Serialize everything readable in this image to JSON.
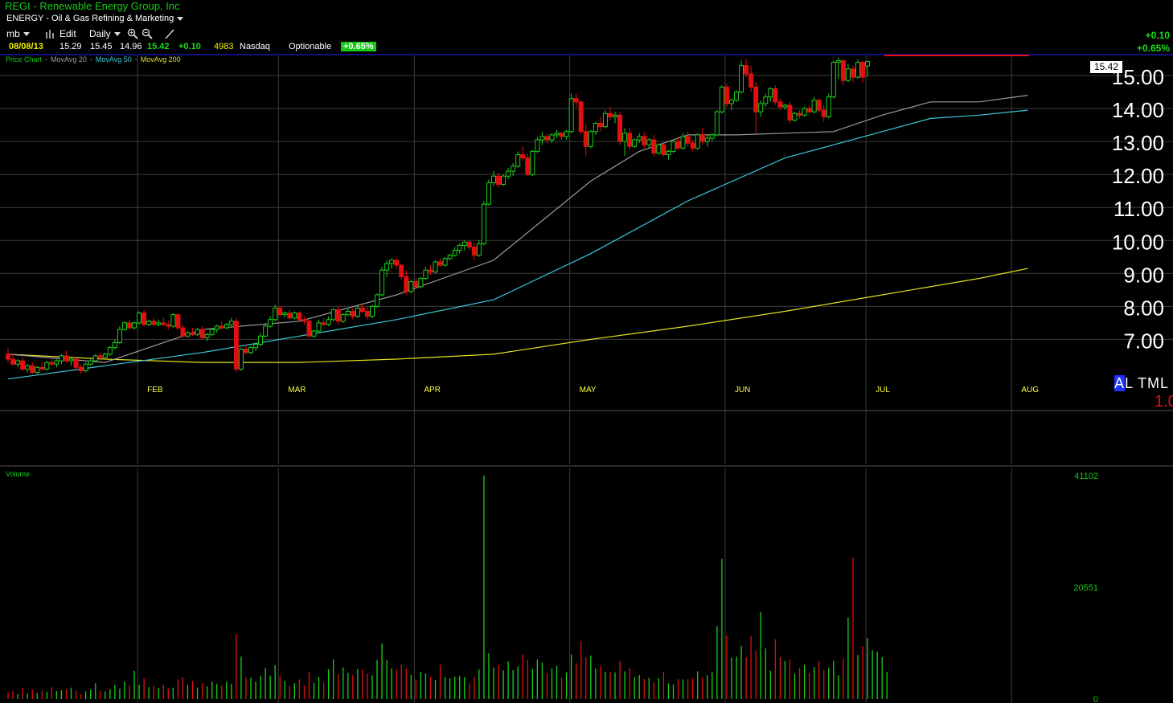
{
  "header": {
    "title": "REGI - Renewable Energy Group, Inc",
    "sector": "ENERGY - Oil & Gas Refining & Marketing",
    "toolbar": {
      "profile": "mb",
      "edit": "Edit",
      "period": "Daily"
    },
    "quote": {
      "date": "08/08/13",
      "open": "15.29",
      "high": "15.45",
      "low": "14.96",
      "close": "15.42",
      "change": "+0.10",
      "volume": "4983",
      "exchange": "Nasdaq",
      "optionable": "Optionable",
      "pct": "+0.65%"
    },
    "right_change": "+0.10",
    "right_pct": "+0.65%"
  },
  "legend": {
    "price": "Price Chart",
    "ma20": "MovAvg 20",
    "ma50": "MovAvg 50",
    "ma200": "MovAvg 200"
  },
  "volume_label": "Volume",
  "last_price_label": "15.42",
  "tml": {
    "a": "A",
    "rest": "L TML",
    "value": "1.0"
  },
  "colors": {
    "up": "#18d018",
    "down": "#e01010",
    "ma20": "#9a9a9a",
    "ma50": "#3cc8d8",
    "ma200": "#e0e020",
    "grid": "#3c3c3c",
    "axis_text": "#ffffff"
  },
  "chart_data": {
    "type": "candlestick",
    "y_range": [
      6.0,
      15.6
    ],
    "y_ticks": [
      "15.00",
      "14.00",
      "13.00",
      "12.00",
      "11.00",
      "10.00",
      "9.00",
      "8.00",
      "7.00"
    ],
    "month_labels": [
      {
        "label": "FEB",
        "index": 28
      },
      {
        "label": "MAR",
        "index": 57
      },
      {
        "label": "APR",
        "index": 85
      },
      {
        "label": "MAY",
        "index": 117
      },
      {
        "label": "JUN",
        "index": 149
      },
      {
        "label": "JUL",
        "index": 178
      },
      {
        "label": "AUG",
        "index": 208
      }
    ],
    "bars": [
      [
        6.55,
        6.75,
        6.3,
        6.4
      ],
      [
        6.4,
        6.55,
        6.2,
        6.25
      ],
      [
        6.25,
        6.4,
        6.15,
        6.35
      ],
      [
        6.35,
        6.45,
        6.05,
        6.1
      ],
      [
        6.1,
        6.25,
        6.0,
        6.2
      ],
      [
        6.2,
        6.3,
        5.95,
        6.0
      ],
      [
        6.0,
        6.2,
        5.95,
        6.15
      ],
      [
        6.15,
        6.3,
        6.05,
        6.1
      ],
      [
        6.1,
        6.35,
        6.05,
        6.3
      ],
      [
        6.3,
        6.45,
        6.2,
        6.25
      ],
      [
        6.25,
        6.4,
        6.15,
        6.35
      ],
      [
        6.35,
        6.55,
        6.25,
        6.5
      ],
      [
        6.5,
        6.65,
        6.3,
        6.35
      ],
      [
        6.35,
        6.45,
        6.2,
        6.4
      ],
      [
        6.4,
        6.45,
        6.1,
        6.15
      ],
      [
        6.15,
        6.25,
        5.95,
        6.05
      ],
      [
        6.05,
        6.3,
        6.0,
        6.25
      ],
      [
        6.25,
        6.4,
        6.2,
        6.35
      ],
      [
        6.35,
        6.55,
        6.3,
        6.5
      ],
      [
        6.5,
        6.6,
        6.35,
        6.45
      ],
      [
        6.45,
        6.6,
        6.4,
        6.55
      ],
      [
        6.55,
        6.8,
        6.5,
        6.75
      ],
      [
        6.75,
        7.0,
        6.7,
        6.9
      ],
      [
        6.9,
        7.4,
        6.85,
        7.3
      ],
      [
        7.3,
        7.55,
        7.25,
        7.5
      ],
      [
        7.5,
        7.6,
        7.3,
        7.35
      ],
      [
        7.35,
        7.55,
        7.3,
        7.5
      ],
      [
        7.5,
        7.85,
        7.45,
        7.8
      ],
      [
        7.8,
        7.9,
        7.4,
        7.45
      ],
      [
        7.45,
        7.6,
        7.4,
        7.55
      ],
      [
        7.55,
        7.65,
        7.4,
        7.45
      ],
      [
        7.45,
        7.6,
        7.4,
        7.5
      ],
      [
        7.5,
        7.65,
        7.4,
        7.45
      ],
      [
        7.45,
        7.55,
        7.3,
        7.4
      ],
      [
        7.4,
        7.8,
        7.35,
        7.75
      ],
      [
        7.75,
        7.8,
        7.3,
        7.35
      ],
      [
        7.35,
        7.45,
        7.05,
        7.1
      ],
      [
        7.1,
        7.25,
        7.05,
        7.2
      ],
      [
        7.2,
        7.35,
        7.1,
        7.15
      ],
      [
        7.15,
        7.35,
        7.1,
        7.3
      ],
      [
        7.3,
        7.4,
        7.0,
        7.05
      ],
      [
        7.05,
        7.2,
        6.95,
        7.15
      ],
      [
        7.15,
        7.35,
        7.1,
        7.3
      ],
      [
        7.3,
        7.45,
        7.2,
        7.4
      ],
      [
        7.4,
        7.55,
        7.3,
        7.35
      ],
      [
        7.35,
        7.5,
        7.3,
        7.45
      ],
      [
        7.45,
        7.65,
        7.4,
        7.55
      ],
      [
        7.55,
        7.65,
        6.0,
        6.1
      ],
      [
        6.1,
        6.75,
        6.05,
        6.7
      ],
      [
        6.7,
        6.85,
        6.55,
        6.6
      ],
      [
        6.6,
        6.8,
        6.55,
        6.75
      ],
      [
        6.75,
        6.9,
        6.65,
        6.85
      ],
      [
        6.85,
        7.2,
        6.8,
        7.1
      ],
      [
        7.1,
        7.5,
        7.05,
        7.4
      ],
      [
        7.4,
        7.7,
        7.35,
        7.6
      ],
      [
        7.6,
        8.05,
        7.55,
        7.95
      ],
      [
        7.95,
        8.0,
        7.7,
        7.75
      ],
      [
        7.75,
        7.85,
        7.65,
        7.8
      ],
      [
        7.8,
        7.9,
        7.6,
        7.65
      ],
      [
        7.65,
        7.85,
        7.6,
        7.8
      ],
      [
        7.8,
        7.85,
        7.55,
        7.6
      ],
      [
        7.6,
        7.7,
        7.45,
        7.55
      ],
      [
        7.55,
        7.6,
        7.05,
        7.1
      ],
      [
        7.1,
        7.3,
        7.05,
        7.25
      ],
      [
        7.25,
        7.6,
        7.2,
        7.5
      ],
      [
        7.5,
        7.65,
        7.4,
        7.45
      ],
      [
        7.45,
        7.7,
        7.4,
        7.6
      ],
      [
        7.6,
        7.95,
        7.55,
        7.9
      ],
      [
        7.9,
        8.0,
        7.45,
        7.55
      ],
      [
        7.55,
        7.8,
        7.5,
        7.75
      ],
      [
        7.75,
        7.95,
        7.7,
        7.85
      ],
      [
        7.85,
        7.95,
        7.6,
        7.7
      ],
      [
        7.7,
        8.05,
        7.65,
        7.95
      ],
      [
        7.95,
        8.1,
        7.8,
        7.85
      ],
      [
        7.85,
        8.0,
        7.6,
        7.7
      ],
      [
        7.7,
        8.05,
        7.65,
        8.0
      ],
      [
        8.0,
        8.4,
        7.95,
        8.35
      ],
      [
        8.35,
        9.2,
        8.3,
        9.1
      ],
      [
        9.1,
        9.4,
        8.9,
        9.3
      ],
      [
        9.3,
        9.45,
        9.15,
        9.4
      ],
      [
        9.4,
        9.45,
        9.15,
        9.25
      ],
      [
        9.25,
        9.3,
        8.8,
        8.9
      ],
      [
        8.9,
        9.1,
        8.35,
        8.45
      ],
      [
        8.45,
        8.8,
        8.4,
        8.75
      ],
      [
        8.75,
        8.85,
        8.55,
        8.6
      ],
      [
        8.6,
        8.9,
        8.55,
        8.85
      ],
      [
        8.85,
        9.2,
        8.8,
        9.1
      ],
      [
        9.1,
        9.25,
        8.95,
        9.05
      ],
      [
        9.05,
        9.4,
        9.0,
        9.35
      ],
      [
        9.35,
        9.45,
        9.2,
        9.25
      ],
      [
        9.25,
        9.5,
        9.2,
        9.45
      ],
      [
        9.45,
        9.6,
        9.4,
        9.55
      ],
      [
        9.55,
        9.8,
        9.5,
        9.7
      ],
      [
        9.7,
        9.9,
        9.6,
        9.85
      ],
      [
        9.85,
        10.0,
        9.7,
        9.95
      ],
      [
        9.95,
        10.0,
        9.7,
        9.8
      ],
      [
        9.8,
        9.95,
        9.4,
        9.55
      ],
      [
        9.55,
        10.0,
        9.5,
        9.9
      ],
      [
        9.9,
        11.2,
        9.85,
        11.1
      ],
      [
        11.1,
        11.85,
        11.05,
        11.75
      ],
      [
        11.75,
        12.1,
        11.65,
        11.95
      ],
      [
        11.95,
        12.05,
        11.6,
        11.7
      ],
      [
        11.7,
        12.0,
        11.65,
        11.95
      ],
      [
        11.95,
        12.2,
        11.85,
        12.1
      ],
      [
        12.1,
        12.35,
        11.95,
        12.25
      ],
      [
        12.25,
        12.7,
        12.2,
        12.6
      ],
      [
        12.6,
        12.85,
        12.4,
        12.5
      ],
      [
        12.5,
        12.65,
        11.95,
        12.0
      ],
      [
        12.0,
        12.75,
        11.95,
        12.7
      ],
      [
        12.7,
        13.15,
        12.65,
        13.05
      ],
      [
        13.05,
        13.3,
        12.9,
        13.15
      ],
      [
        13.15,
        13.25,
        12.95,
        13.05
      ],
      [
        13.05,
        13.25,
        12.95,
        13.2
      ],
      [
        13.2,
        13.35,
        13.1,
        13.25
      ],
      [
        13.25,
        13.3,
        13.05,
        13.15
      ],
      [
        13.15,
        13.35,
        13.05,
        13.3
      ],
      [
        13.3,
        14.45,
        13.25,
        14.3
      ],
      [
        14.3,
        14.45,
        14.05,
        14.2
      ],
      [
        14.2,
        14.25,
        13.2,
        13.3
      ],
      [
        13.3,
        13.55,
        12.55,
        12.85
      ],
      [
        12.85,
        13.35,
        12.8,
        13.3
      ],
      [
        13.3,
        13.6,
        13.2,
        13.55
      ],
      [
        13.55,
        13.75,
        13.3,
        13.45
      ],
      [
        13.45,
        13.95,
        13.4,
        13.85
      ],
      [
        13.85,
        14.05,
        13.65,
        13.75
      ],
      [
        13.75,
        13.9,
        13.55,
        13.8
      ],
      [
        13.8,
        13.9,
        12.9,
        13.0
      ],
      [
        13.0,
        13.4,
        12.55,
        13.25
      ],
      [
        13.25,
        13.4,
        12.75,
        12.85
      ],
      [
        12.85,
        13.1,
        12.8,
        13.05
      ],
      [
        13.05,
        13.25,
        12.95,
        13.15
      ],
      [
        13.15,
        13.3,
        12.8,
        12.9
      ],
      [
        12.9,
        13.1,
        12.8,
        13.05
      ],
      [
        13.05,
        13.2,
        12.55,
        12.65
      ],
      [
        12.65,
        12.95,
        12.6,
        12.9
      ],
      [
        12.9,
        13.0,
        12.55,
        12.6
      ],
      [
        12.6,
        12.75,
        12.45,
        12.7
      ],
      [
        12.7,
        13.05,
        12.65,
        13.0
      ],
      [
        13.0,
        13.15,
        12.75,
        12.8
      ],
      [
        12.8,
        13.25,
        12.75,
        13.15
      ],
      [
        13.15,
        13.3,
        12.85,
        12.95
      ],
      [
        12.95,
        13.05,
        12.7,
        12.8
      ],
      [
        12.8,
        13.25,
        12.75,
        13.2
      ],
      [
        13.2,
        13.4,
        12.9,
        13.0
      ],
      [
        13.0,
        13.2,
        12.85,
        13.1
      ],
      [
        13.1,
        13.25,
        13.0,
        13.2
      ],
      [
        13.2,
        13.95,
        13.15,
        13.9
      ],
      [
        13.9,
        14.7,
        13.85,
        14.65
      ],
      [
        14.65,
        14.75,
        14.05,
        14.15
      ],
      [
        14.15,
        14.3,
        13.95,
        14.25
      ],
      [
        14.25,
        14.55,
        14.2,
        14.5
      ],
      [
        14.5,
        15.45,
        14.45,
        15.3
      ],
      [
        15.3,
        15.5,
        14.95,
        15.05
      ],
      [
        15.05,
        15.3,
        14.5,
        14.65
      ],
      [
        14.65,
        14.8,
        13.25,
        13.9
      ],
      [
        13.9,
        14.25,
        13.75,
        14.15
      ],
      [
        14.15,
        14.45,
        14.05,
        14.35
      ],
      [
        14.35,
        14.65,
        14.2,
        14.6
      ],
      [
        14.6,
        14.7,
        14.1,
        14.2
      ],
      [
        14.2,
        14.3,
        13.95,
        14.05
      ],
      [
        14.05,
        14.15,
        13.95,
        14.1
      ],
      [
        14.1,
        14.2,
        13.55,
        13.65
      ],
      [
        13.65,
        13.9,
        13.6,
        13.85
      ],
      [
        13.85,
        13.95,
        13.7,
        13.8
      ],
      [
        13.8,
        14.05,
        13.75,
        14.0
      ],
      [
        14.0,
        14.1,
        13.85,
        13.9
      ],
      [
        13.9,
        14.35,
        13.85,
        14.25
      ],
      [
        14.25,
        14.3,
        13.9,
        13.95
      ],
      [
        13.95,
        14.1,
        13.6,
        13.75
      ],
      [
        13.75,
        14.45,
        13.7,
        14.35
      ],
      [
        14.35,
        15.45,
        14.3,
        15.4
      ],
      [
        15.4,
        15.55,
        14.9,
        15.45
      ],
      [
        15.45,
        15.5,
        14.7,
        14.85
      ],
      [
        14.85,
        15.35,
        14.8,
        15.2
      ],
      [
        15.2,
        15.3,
        14.8,
        14.95
      ],
      [
        14.95,
        15.5,
        14.9,
        15.4
      ],
      [
        15.4,
        15.45,
        14.8,
        14.95
      ],
      [
        15.29,
        15.45,
        14.96,
        15.42
      ]
    ],
    "ma20_points": [
      [
        0,
        6.55
      ],
      [
        20,
        6.3
      ],
      [
        40,
        7.3
      ],
      [
        60,
        7.55
      ],
      [
        80,
        8.35
      ],
      [
        100,
        9.4
      ],
      [
        110,
        10.6
      ],
      [
        120,
        11.8
      ],
      [
        130,
        12.7
      ],
      [
        140,
        13.2
      ],
      [
        150,
        13.2
      ],
      [
        160,
        13.25
      ],
      [
        170,
        13.3
      ],
      [
        180,
        13.8
      ],
      [
        190,
        14.2
      ],
      [
        200,
        14.2
      ],
      [
        210,
        14.4
      ]
    ],
    "ma50_points": [
      [
        0,
        5.8
      ],
      [
        20,
        6.2
      ],
      [
        40,
        6.6
      ],
      [
        60,
        7.1
      ],
      [
        80,
        7.6
      ],
      [
        100,
        8.2
      ],
      [
        120,
        9.6
      ],
      [
        140,
        11.2
      ],
      [
        160,
        12.5
      ],
      [
        180,
        13.3
      ],
      [
        190,
        13.7
      ],
      [
        200,
        13.8
      ],
      [
        210,
        13.95
      ]
    ],
    "ma200_points": [
      [
        0,
        6.55
      ],
      [
        20,
        6.4
      ],
      [
        40,
        6.3
      ],
      [
        60,
        6.3
      ],
      [
        80,
        6.4
      ],
      [
        100,
        6.55
      ],
      [
        120,
        7.0
      ],
      [
        140,
        7.4
      ],
      [
        160,
        7.85
      ],
      [
        180,
        8.35
      ],
      [
        200,
        8.85
      ],
      [
        210,
        9.15
      ]
    ],
    "volume": {
      "y_ticks": [
        "41102",
        "20551",
        "0"
      ],
      "max": 41102,
      "values": [
        1200,
        1500,
        900,
        2000,
        1000,
        1800,
        1100,
        1500,
        1300,
        2200,
        1500,
        1600,
        1800,
        2100,
        1600,
        900,
        1400,
        1700,
        2900,
        1500,
        1400,
        1800,
        2600,
        1900,
        3200,
        2500,
        5200,
        2600,
        3800,
        2200,
        2400,
        2000,
        2600,
        1900,
        2100,
        3600,
        4000,
        2600,
        3300,
        2100,
        2900,
        2300,
        3200,
        2800,
        2500,
        3200,
        2800,
        12000,
        7800,
        4000,
        3900,
        3200,
        4300,
        5700,
        4300,
        6200,
        4300,
        3300,
        2400,
        2900,
        3600,
        2500,
        5000,
        3000,
        4000,
        3000,
        5500,
        7300,
        4600,
        5800,
        4800,
        4400,
        5500,
        5400,
        4700,
        4400,
        7200,
        10200,
        7100,
        5600,
        5500,
        6300,
        5600,
        4500,
        3600,
        5000,
        4700,
        4100,
        3500,
        6300,
        4000,
        3800,
        4100,
        4200,
        4000,
        2900,
        4100,
        5400,
        41102,
        8400,
        5800,
        6300,
        5300,
        6900,
        5300,
        6000,
        8200,
        7200,
        5500,
        7300,
        6700,
        4800,
        5600,
        6100,
        3900,
        4900,
        8200,
        6600,
        10700,
        7700,
        8000,
        5600,
        6000,
        5000,
        5000,
        4900,
        7000,
        5100,
        5700,
        4000,
        4400,
        3700,
        3900,
        3100,
        3800,
        5000,
        2900,
        2700,
        3700,
        3600,
        3600,
        3800,
        5100,
        4000,
        4400,
        4900,
        13400,
        25800,
        11700,
        7600,
        7800,
        9800,
        7700,
        11600,
        8900,
        16000,
        9300,
        5200,
        11000,
        7700,
        7000,
        7200,
        4600,
        5700,
        6300,
        4800,
        5900,
        7000,
        5300,
        5700,
        7000,
        4400,
        7400,
        15000,
        26000,
        8100,
        9700,
        11200,
        9000,
        8700,
        7700,
        4983
      ]
    }
  }
}
